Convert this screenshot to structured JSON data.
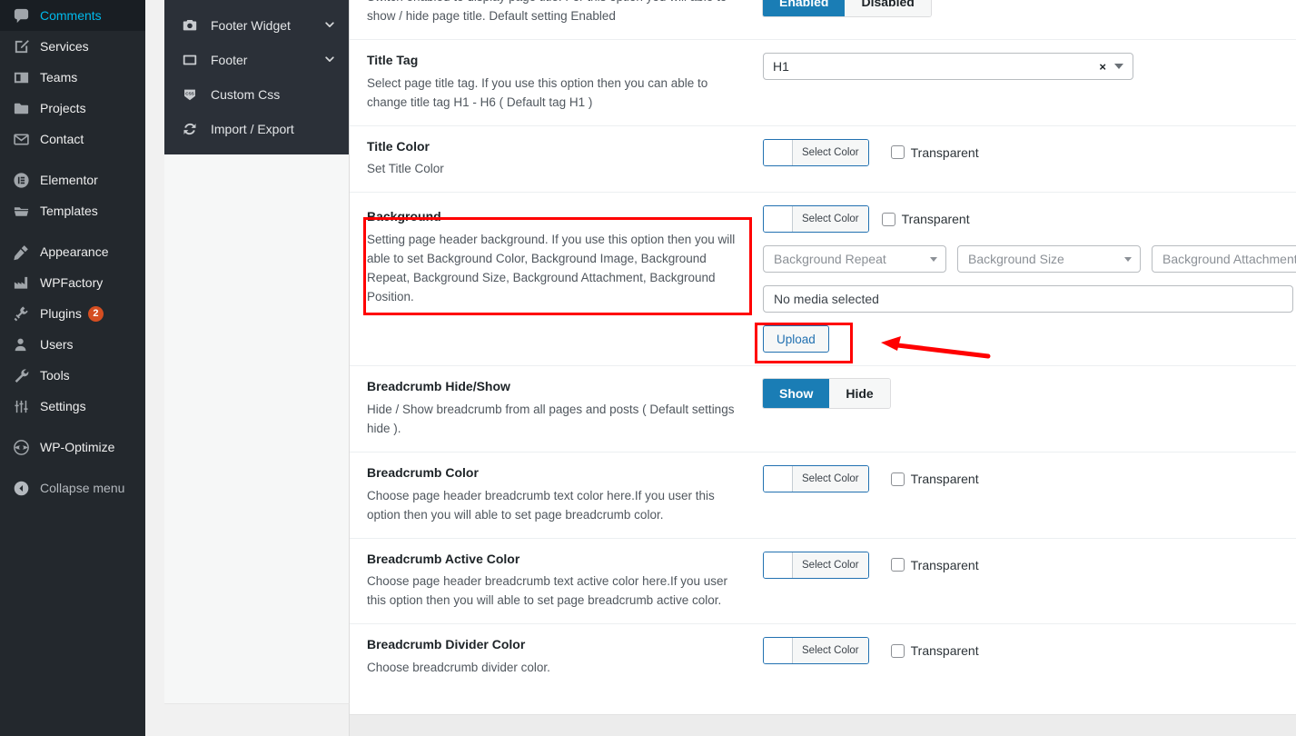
{
  "sidebar": {
    "items": [
      {
        "label": "Comments",
        "icon": "comments-icon",
        "badge": null
      },
      {
        "label": "Services",
        "icon": "services-icon",
        "badge": null
      },
      {
        "label": "Teams",
        "icon": "teams-icon",
        "badge": null
      },
      {
        "label": "Projects",
        "icon": "projects-icon",
        "badge": null
      },
      {
        "label": "Contact",
        "icon": "contact-icon",
        "badge": null
      },
      {
        "label": "Elementor",
        "icon": "elementor-icon",
        "badge": null
      },
      {
        "label": "Templates",
        "icon": "templates-icon",
        "badge": null
      },
      {
        "label": "Appearance",
        "icon": "appearance-icon",
        "badge": null
      },
      {
        "label": "WPFactory",
        "icon": "wpfactory-icon",
        "badge": null
      },
      {
        "label": "Plugins",
        "icon": "plugins-icon",
        "badge": "2"
      },
      {
        "label": "Users",
        "icon": "users-icon",
        "badge": null
      },
      {
        "label": "Tools",
        "icon": "tools-icon",
        "badge": null
      },
      {
        "label": "Settings",
        "icon": "settings-icon",
        "badge": null
      },
      {
        "label": "WP-Optimize",
        "icon": "wp-optimize-icon",
        "badge": null
      },
      {
        "label": "Collapse menu",
        "icon": "collapse-menu-icon",
        "badge": null
      }
    ]
  },
  "options_panel": {
    "items": [
      {
        "label": "Footer Widget",
        "icon": "camera-icon",
        "expandable": true
      },
      {
        "label": "Footer",
        "icon": "monitor-icon",
        "expandable": true
      },
      {
        "label": "Custom Css",
        "icon": "css-icon",
        "expandable": false
      },
      {
        "label": "Import / Export",
        "icon": "refresh-icon",
        "expandable": false
      }
    ]
  },
  "settings": {
    "page_title_row": {
      "desc_clipped": "Switch enabled to display page title. For this option you will able to show / hide page title. Default setting Enabled",
      "toggle": {
        "on_label": "Enabled",
        "off_label": "Disabled",
        "selected": "Enabled"
      }
    },
    "rows": [
      {
        "title": "Title Tag",
        "desc": "Select page title tag. If you use this option then you can able to change title tag H1 - H6 ( Default tag H1 )",
        "control": "select2",
        "value": "H1",
        "clear_glyph": "×"
      },
      {
        "title": "Title Color",
        "desc": "Set Title Color",
        "control": "color",
        "color_label": "Select Color",
        "checkbox_label": "Transparent",
        "checked": false
      },
      {
        "title": "Background",
        "desc": "Setting page header background. If you use this option then you will able to set Background Color, Background Image, Background Repeat, Background Size, Background Attachment, Background Position.",
        "control": "background",
        "color_label": "Select Color",
        "checkbox_label": "Transparent",
        "checked": false,
        "selects": [
          "Background Repeat",
          "Background Size",
          "Background Attachment"
        ],
        "media_value": "No media selected",
        "upload_label": "Upload",
        "highlighted": true
      },
      {
        "title": "Breadcrumb Hide/Show",
        "desc": "Hide / Show breadcrumb from all pages and posts ( Default settings hide ).",
        "control": "toggle",
        "toggle": {
          "on_label": "Show",
          "off_label": "Hide",
          "selected": "Show"
        }
      },
      {
        "title": "Breadcrumb Color",
        "desc": "Choose page header breadcrumb text color here.If you user this option then you will able to set page breadcrumb color.",
        "control": "color",
        "color_label": "Select Color",
        "checkbox_label": "Transparent",
        "checked": false
      },
      {
        "title": "Breadcrumb Active Color",
        "desc": "Choose page header breadcrumb text active color here.If you user this option then you will able to set page breadcrumb active color.",
        "control": "color",
        "color_label": "Select Color",
        "checkbox_label": "Transparent",
        "checked": false
      },
      {
        "title": "Breadcrumb Divider Color",
        "desc": "Choose breadcrumb divider color.",
        "control": "color",
        "color_label": "Select Color",
        "checkbox_label": "Transparent",
        "checked": false
      }
    ]
  },
  "annotations": {
    "background_box": {
      "label": "background-setting-highlight"
    },
    "upload_box": {
      "label": "upload-button-highlight"
    },
    "arrow": {
      "label": "pointer-arrow-to-upload"
    }
  },
  "colors": {
    "accent_blue": "#1a7db5",
    "link_blue": "#2271b1",
    "annotation_red": "#ff0000",
    "sidebar_bg": "#23282d",
    "subpanel_bg": "#2b3038",
    "badge_red": "#d54e21"
  }
}
